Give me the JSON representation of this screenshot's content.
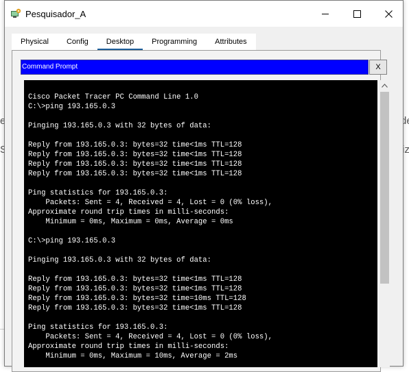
{
  "window": {
    "title": "Pesquisador_A",
    "icon": "cisco-pc-icon"
  },
  "tabs": [
    "Physical",
    "Config",
    "Desktop",
    "Programming",
    "Attributes"
  ],
  "active_tab": "Desktop",
  "command_prompt": {
    "title": "Command Prompt",
    "close_label": "X",
    "lines": [
      "Cisco Packet Tracer PC Command Line 1.0",
      "C:\\>ping 193.165.0.3",
      "",
      "Pinging 193.165.0.3 with 32 bytes of data:",
      "",
      "Reply from 193.165.0.3: bytes=32 time<1ms TTL=128",
      "Reply from 193.165.0.3: bytes=32 time<1ms TTL=128",
      "Reply from 193.165.0.3: bytes=32 time<1ms TTL=128",
      "Reply from 193.165.0.3: bytes=32 time<1ms TTL=128",
      "",
      "Ping statistics for 193.165.0.3:",
      "    Packets: Sent = 4, Received = 4, Lost = 0 (0% loss),",
      "Approximate round trip times in milli-seconds:",
      "    Minimum = 0ms, Maximum = 0ms, Average = 0ms",
      "",
      "C:\\>ping 193.165.0.3",
      "",
      "Pinging 193.165.0.3 with 32 bytes of data:",
      "",
      "Reply from 193.165.0.3: bytes=32 time<1ms TTL=128",
      "Reply from 193.165.0.3: bytes=32 time<1ms TTL=128",
      "Reply from 193.165.0.3: bytes=32 time=10ms TTL=128",
      "Reply from 193.165.0.3: bytes=32 time<1ms TTL=128",
      "",
      "Ping statistics for 193.165.0.3:",
      "    Packets: Sent = 4, Received = 4, Lost = 0 (0% loss),",
      "Approximate round trip times in milli-seconds:",
      "    Minimum = 0ms, Maximum = 10ms, Average = 2ms"
    ]
  },
  "background_fragments": {
    "left_1": "e",
    "left_2": "S",
    "right_1": "de",
    "right_2": "iz"
  },
  "colors": {
    "cmd_header": "#0000ff",
    "terminal_bg": "#000000",
    "terminal_text": "#ffffff",
    "active_tab_underline": "#1c5d9a"
  }
}
